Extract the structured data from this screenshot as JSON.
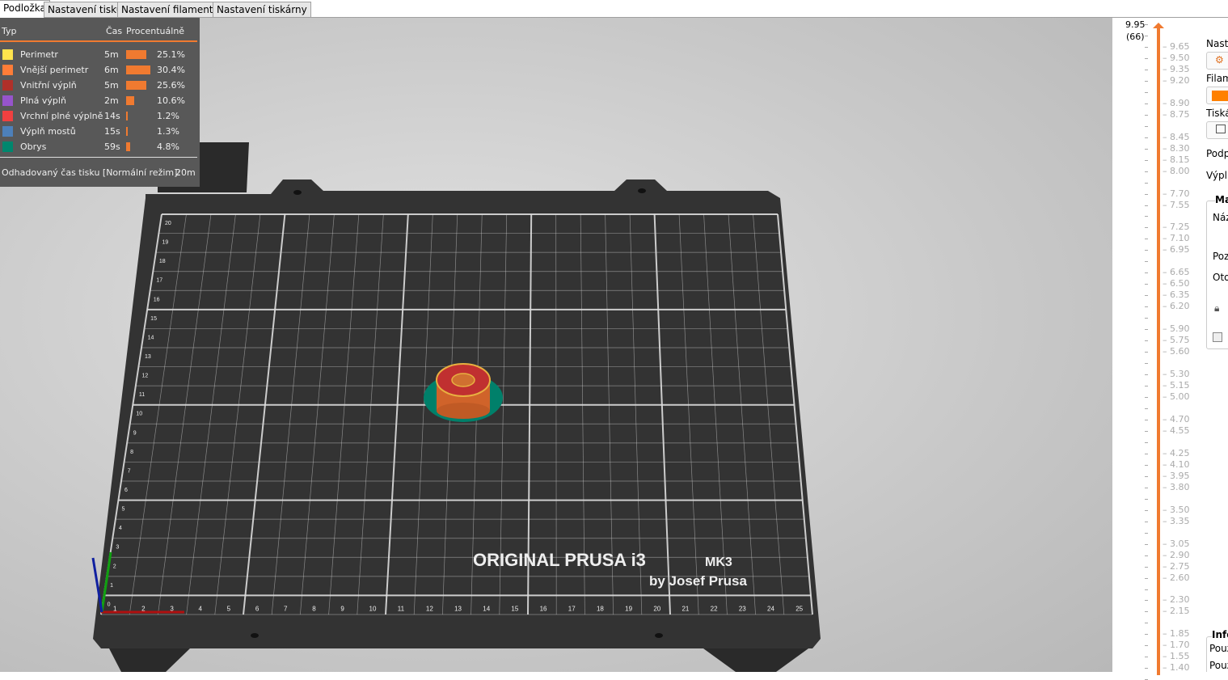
{
  "tabs": [
    "Podložka",
    "Nastavení tisku",
    "Nastavení filamentu",
    "Nastavení tiskárny"
  ],
  "legend": {
    "headers": {
      "type": "Typ",
      "time": "Čas",
      "percent": "Procentuálně"
    },
    "rows": [
      {
        "label": "Perimetr",
        "time": "5m",
        "percent": "25.1%",
        "value": 25.1,
        "color": "#ffe44d"
      },
      {
        "label": "Vnější perimetr",
        "time": "6m",
        "percent": "30.4%",
        "value": 30.4,
        "color": "#ff7d38"
      },
      {
        "label": "Vnitřní výplň",
        "time": "5m",
        "percent": "25.6%",
        "value": 25.6,
        "color": "#b03029"
      },
      {
        "label": "Plná výplň",
        "time": "2m",
        "percent": "10.6%",
        "value": 10.6,
        "color": "#9654cc"
      },
      {
        "label": "Vrchní plné výplně",
        "time": "14s",
        "percent": "1.2%",
        "value": 1.2,
        "color": "#f04040"
      },
      {
        "label": "Výplň mostů",
        "time": "15s",
        "percent": "1.3%",
        "value": 1.3,
        "color": "#4d80ba"
      },
      {
        "label": "Obrys",
        "time": "59s",
        "percent": "4.8%",
        "value": 4.8,
        "color": "#00876e"
      }
    ],
    "estimate_label": "Odhadovaný čas tisku [Normální režim]:",
    "estimate_value": "20m"
  },
  "bed": {
    "brand": "ORIGINAL PRUSA i3",
    "model": "MK3",
    "author": "by Josef Prusa",
    "x_ticks": [
      "1",
      "2",
      "3",
      "4",
      "5",
      "6",
      "7",
      "8",
      "9",
      "10",
      "11",
      "12",
      "13",
      "14",
      "15",
      "16",
      "17",
      "18",
      "19",
      "20",
      "21",
      "22",
      "23",
      "24",
      "25"
    ],
    "y_ticks": [
      "0",
      "1",
      "2",
      "3",
      "4",
      "5",
      "6",
      "7",
      "8",
      "9",
      "10",
      "11",
      "12",
      "13",
      "14",
      "15",
      "16",
      "17",
      "18",
      "19",
      "20"
    ]
  },
  "slider": {
    "top_value": "9.95",
    "top_layer": "(66)",
    "accent": "#f07a30",
    "labels": [
      "9.65",
      "9.50",
      "9.35",
      "9.20",
      "8.90",
      "8.75",
      "8.45",
      "8.30",
      "8.15",
      "8.00",
      "7.70",
      "7.55",
      "7.25",
      "7.10",
      "6.95",
      "6.65",
      "6.50",
      "6.35",
      "6.20",
      "5.90",
      "5.75",
      "5.60",
      "5.30",
      "5.15",
      "5.00",
      "4.70",
      "4.55",
      "4.25",
      "4.10",
      "3.95",
      "3.80",
      "3.50",
      "3.35",
      "3.05",
      "2.90",
      "2.75",
      "2.60",
      "2.30",
      "2.15",
      "1.85",
      "1.70",
      "1.55",
      "1.40"
    ]
  },
  "side": {
    "settings": "Nasta",
    "filament": "Filam",
    "printer": "Tiská",
    "supports": "Podp",
    "infill": "Výplň",
    "manip": "Ma",
    "name": "Náz",
    "position": "Poz",
    "rotation": "Oto",
    "info": "Info",
    "used1": "Pouz",
    "used2": "Pouz",
    "filament_color": "#ff8000"
  }
}
